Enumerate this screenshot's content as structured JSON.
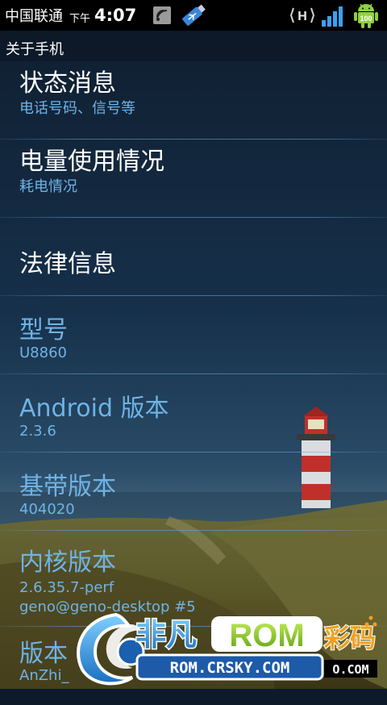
{
  "status_bar": {
    "carrier": "中国联通",
    "am_pm": "下午",
    "time": "4:07",
    "network_type": "H",
    "battery_level": "100",
    "icons": [
      "rss-icon",
      "usb-icon",
      "network-h-icon",
      "signal-icon",
      "android-battery-icon"
    ]
  },
  "title": "关于手机",
  "items": [
    {
      "title": "状态消息",
      "subtitle": "电话号码、信号等",
      "style": "white"
    },
    {
      "title": "电量使用情况",
      "subtitle": "耗电情况",
      "style": "white"
    },
    {
      "title": "法律信息",
      "subtitle": "",
      "style": "white"
    },
    {
      "title": "型号",
      "subtitle": "U8860",
      "style": "blue"
    },
    {
      "title": "Android 版本",
      "subtitle": "2.3.6",
      "style": "blue"
    },
    {
      "title": "基带版本",
      "subtitle": "404020",
      "style": "blue"
    },
    {
      "title": "内核版本",
      "subtitle": "2.6.35.7-perf",
      "subtitle2": "geno@geno-desktop #5",
      "style": "blue"
    },
    {
      "title": "版本",
      "subtitle": "AnZhi_",
      "style": "blue"
    }
  ],
  "watermark": {
    "brand": "非凡",
    "rom": "ROM",
    "suffix": "彩码",
    "url": "ROM.CRSKY.COM",
    "url_suffix": "O.COM"
  },
  "colors": {
    "accent_blue": "#6fb3e6",
    "status_bar_bg": "#000000",
    "battery_green": "#8fd13f"
  }
}
